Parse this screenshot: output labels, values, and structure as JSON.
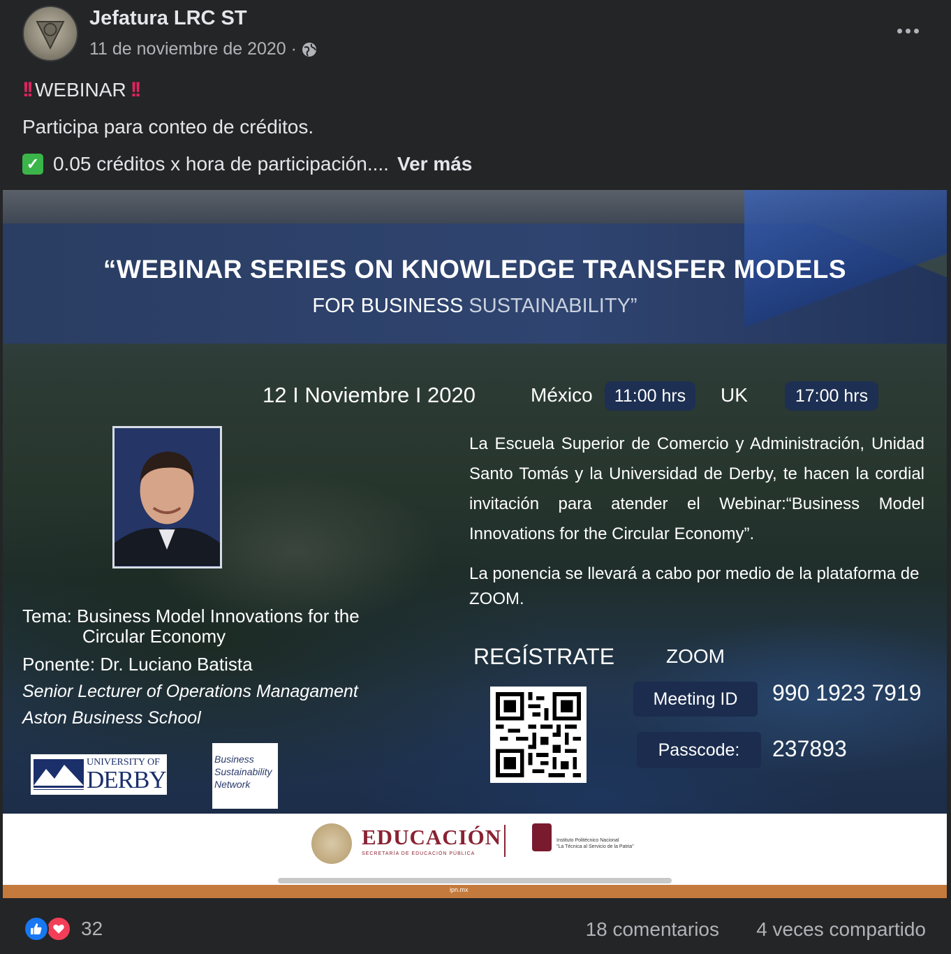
{
  "post": {
    "author": "Jefatura LRC ST",
    "date": "11 de noviembre de 2020 ·",
    "text_line1": "WEBINAR",
    "text_line2": "Participa para conteo de créditos.",
    "text_line3": "0.05 créditos x hora de participación....",
    "see_more": "Ver más"
  },
  "flyer": {
    "title_line1": "“WEBINAR SERIES ON KNOWLEDGE TRANSFER MODELS",
    "title_line2a": "FOR BUSINESS",
    "title_line2b": "SUSTAINABILITY”",
    "date": "12 I Noviembre I 2020",
    "country1": "México",
    "time1": "11:00 hrs",
    "country2": "UK",
    "time2": "17:00 hrs",
    "invite": "La Escuela Superior de Comercio y Administración, Unidad Santo Tomás y la Universidad de Derby, te hacen la cordial invitación para atender el Webinar:“Business Model Innovations for the Circular Economy”.",
    "invite2": "La ponencia se llevará a cabo por medio de la plataforma de ZOOM.",
    "tema_label": "Tema:",
    "tema_line1": "Business Model Innovations for the",
    "tema_line2": "Circular Economy",
    "ponente": "Ponente: Dr. Luciano Batista",
    "senior": "Senior Lecturer of Operations Managament",
    "aston": "Aston Business School",
    "registrate": "REGÍSTRATE",
    "zoom": "ZOOM",
    "meeting_id_label": "Meeting ID",
    "meeting_id": "990 1923 7919",
    "passcode_label": "Passcode:",
    "passcode": "237893",
    "derby_top": "UNIVERSITY OF",
    "derby_bottom": "DERBY",
    "bsn_line1": "Business",
    "bsn_line2": "Sustainability",
    "bsn_line3": "Network",
    "educacion": "EDUCACIÓN",
    "educacion_sub": "SECRETARÍA DE EDUCACIÓN PÚBLICA",
    "ipn_line1": "Instituto Politécnico Nacional",
    "ipn_line2": "\"La Técnica al Servicio de la Patria\"",
    "footer_url": "ipn.mx"
  },
  "footer": {
    "reaction_count": "32",
    "comments": "18 comentarios",
    "shares": "4 veces compartido"
  },
  "colors": {
    "background": "#242526",
    "text_primary": "#e4e6eb",
    "text_secondary": "#b0b3b8",
    "like_blue": "#1877f2",
    "love_red": "#f33e58"
  }
}
